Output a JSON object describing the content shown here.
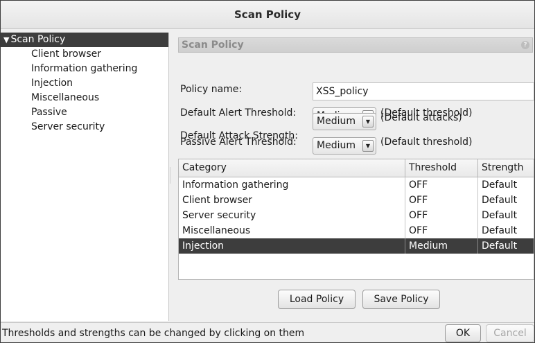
{
  "window": {
    "title": "Scan Policy"
  },
  "tree": {
    "root": {
      "label": "Scan Policy",
      "expanded": true,
      "selected": true
    },
    "items": [
      {
        "label": "Client browser"
      },
      {
        "label": "Information gathering"
      },
      {
        "label": "Injection"
      },
      {
        "label": "Miscellaneous"
      },
      {
        "label": "Passive"
      },
      {
        "label": "Server security"
      }
    ]
  },
  "panel": {
    "title": "Scan Policy",
    "help_icon": "help-icon",
    "policy_name_label": "Policy name:",
    "policy_name_value": "XSS_policy",
    "alert_threshold": {
      "label": "Default Alert Threshold:",
      "value": "Medium",
      "hint": "(Default threshold)"
    },
    "attack_strength": {
      "label": "Default Attack Strength:",
      "value": "Medium",
      "hint": "(Default attacks)"
    },
    "passive_threshold": {
      "label": "Passive Alert Threshold:",
      "value": "Medium",
      "hint": "(Default threshold)"
    }
  },
  "table": {
    "columns": [
      "Category",
      "Threshold",
      "Strength"
    ],
    "rows": [
      {
        "category": "Information gathering",
        "threshold": "OFF",
        "strength": "Default",
        "selected": false
      },
      {
        "category": "Client browser",
        "threshold": "OFF",
        "strength": "Default",
        "selected": false
      },
      {
        "category": "Server security",
        "threshold": "OFF",
        "strength": "Default",
        "selected": false
      },
      {
        "category": "Miscellaneous",
        "threshold": "OFF",
        "strength": "Default",
        "selected": false
      },
      {
        "category": "Injection",
        "threshold": "Medium",
        "strength": "Default",
        "selected": true
      }
    ]
  },
  "buttons": {
    "load": "Load Policy",
    "save": "Save Policy",
    "ok": "OK",
    "cancel": "Cancel",
    "cancel_enabled": false
  },
  "status": {
    "text": "Thresholds and strengths can be changed by clicking on them"
  },
  "colors": {
    "selection": "#3d3d3d",
    "background": "#efefef"
  }
}
